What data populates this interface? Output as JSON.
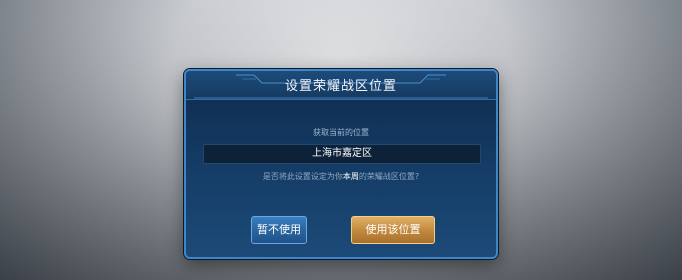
{
  "dialog": {
    "title": "设置荣耀战区位置",
    "location_label": "获取当前的位置",
    "location_value": "上海市嘉定区",
    "confirm_prefix": "是否将此设置设定为你",
    "confirm_highlight": "本周",
    "confirm_suffix": "的荣耀战区位置?",
    "decline_label": "暂不使用",
    "accept_label": "使用该位置"
  },
  "colors": {
    "panel": "#133a63",
    "border": "#3f86c6",
    "decline_button": "#2a659f",
    "accept_button": "#c48b3f"
  }
}
